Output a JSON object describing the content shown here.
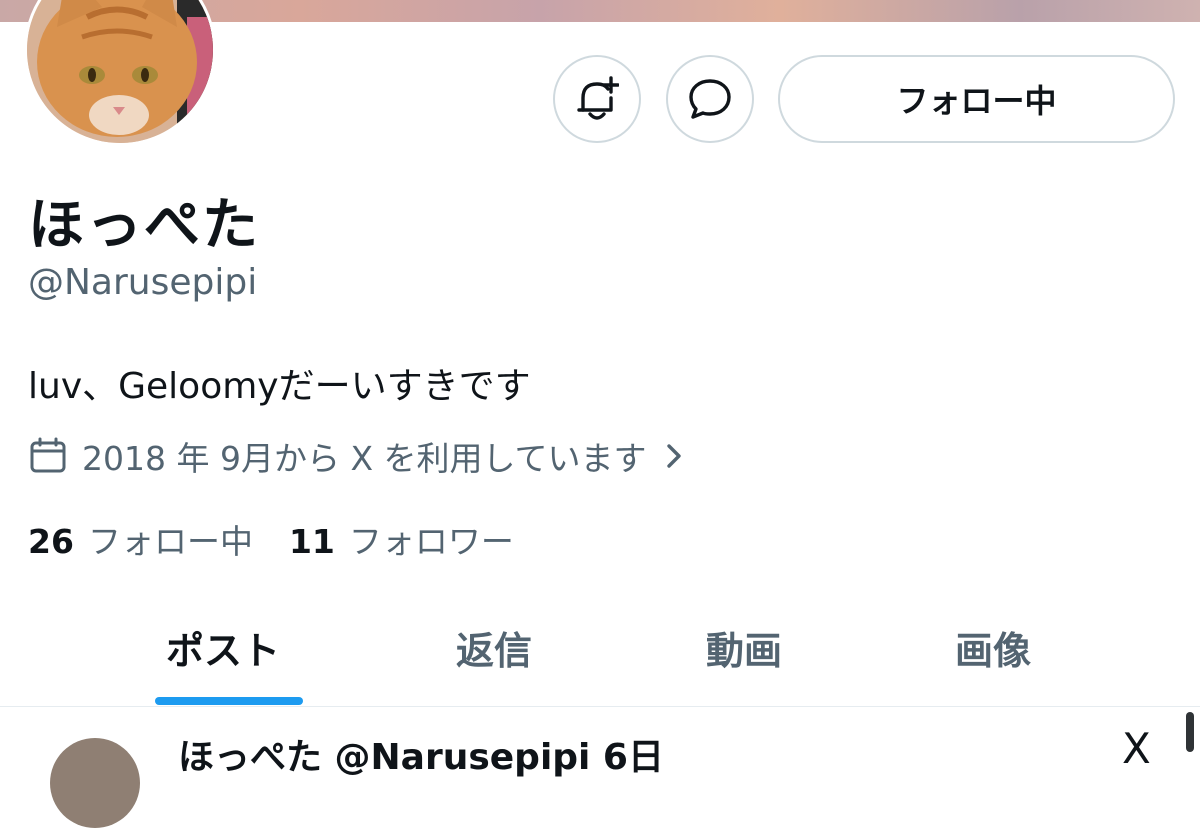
{
  "profile": {
    "name": "ほっぺた",
    "handle": "@Narusepipi",
    "bio": "luv、Geloomyだーいすきです",
    "joined": "2018 年 9月から X を利用しています"
  },
  "actions": {
    "follow_label": "フォロー中"
  },
  "stats": {
    "following_count": "26",
    "following_label": "フォロー中",
    "followers_count": "11",
    "followers_label": "フォロワー"
  },
  "tabs": [
    {
      "label": "ポスト",
      "active": true
    },
    {
      "label": "返信",
      "active": false
    },
    {
      "label": "動画",
      "active": false
    },
    {
      "label": "画像",
      "active": false
    }
  ],
  "peek_post": {
    "text": "ほっぺた @Narusepipi 6日",
    "close_glyph": "X"
  },
  "colors": {
    "accent": "#1d9bf0",
    "secondary_text": "#536471",
    "border": "#cfd9de"
  }
}
